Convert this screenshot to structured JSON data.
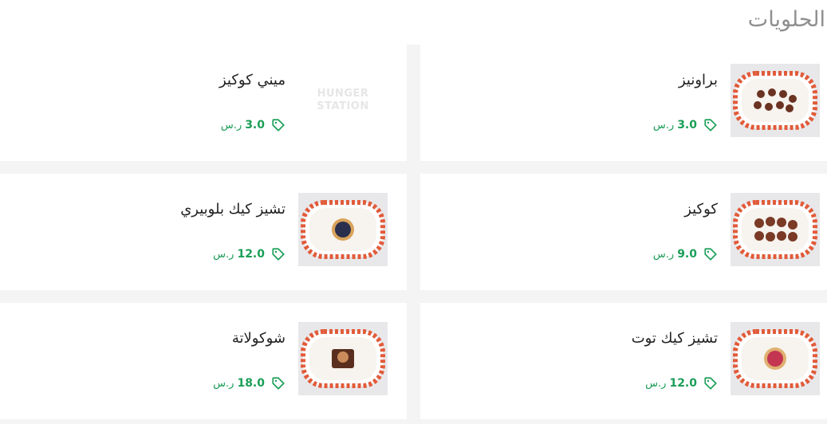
{
  "section": {
    "title": "الحلويات"
  },
  "logo": {
    "line1": "HUNGER",
    "line2": "STATION"
  },
  "items": [
    {
      "name": "براونيز",
      "price": "3.0",
      "currency": "ر.س",
      "image": "brownies-plate"
    },
    {
      "name": "ميني كوكيز",
      "price": "3.0",
      "currency": "ر.س",
      "image": "hungerstation-logo"
    },
    {
      "name": "كوكيز",
      "price": "9.0",
      "currency": "ر.س",
      "image": "cookies-plate"
    },
    {
      "name": "تشيز كيك بلوبيري",
      "price": "12.0",
      "currency": "ر.س",
      "image": "blueberry-cheesecake-plate"
    },
    {
      "name": "تشيز كيك توت",
      "price": "12.0",
      "currency": "ر.س",
      "image": "berry-cheesecake-plate"
    },
    {
      "name": "شوكولاتة",
      "price": "18.0",
      "currency": "ر.س",
      "image": "chocolate-cake-plate"
    }
  ],
  "colors": {
    "price": "#1a9e57",
    "title": "#8f8f8f",
    "plate_accent": "#e25b3a"
  }
}
